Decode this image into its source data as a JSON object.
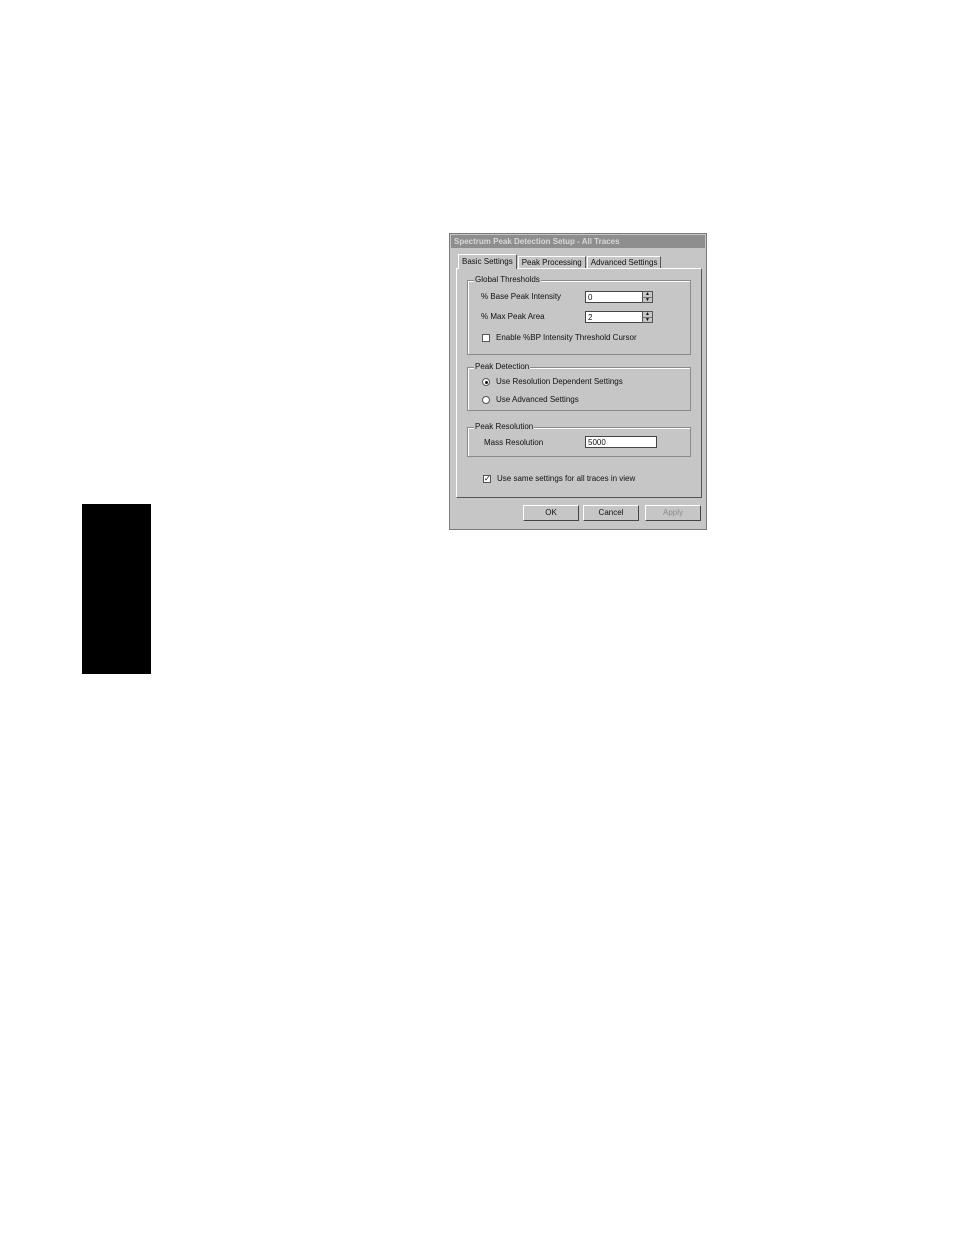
{
  "dialog": {
    "title": "Spectrum Peak Detection Setup - All Traces",
    "tabs": [
      {
        "label": "Basic Settings",
        "active": true
      },
      {
        "label": "Peak Processing",
        "active": false
      },
      {
        "label": "Advanced Settings",
        "active": false
      }
    ],
    "global_thresholds": {
      "title": "Global Thresholds",
      "base_peak_label": "% Base Peak Intensity",
      "base_peak_value": "0",
      "max_peak_area_label": "% Max Peak Area",
      "max_peak_area_value": "2",
      "enable_cursor_label": "Enable %BP Intensity Threshold Cursor",
      "enable_cursor_checked": false
    },
    "peak_detection": {
      "title": "Peak Detection",
      "option_resolution": "Use Resolution Dependent Settings",
      "option_advanced": "Use Advanced Settings",
      "selected": "resolution"
    },
    "peak_resolution": {
      "title": "Peak Resolution",
      "mass_resolution_label": "Mass Resolution",
      "mass_resolution_value": "5000"
    },
    "same_settings_label": "Use same settings for all traces in view",
    "same_settings_checked": true,
    "buttons": {
      "ok": "OK",
      "cancel": "Cancel",
      "apply": "Apply"
    }
  }
}
